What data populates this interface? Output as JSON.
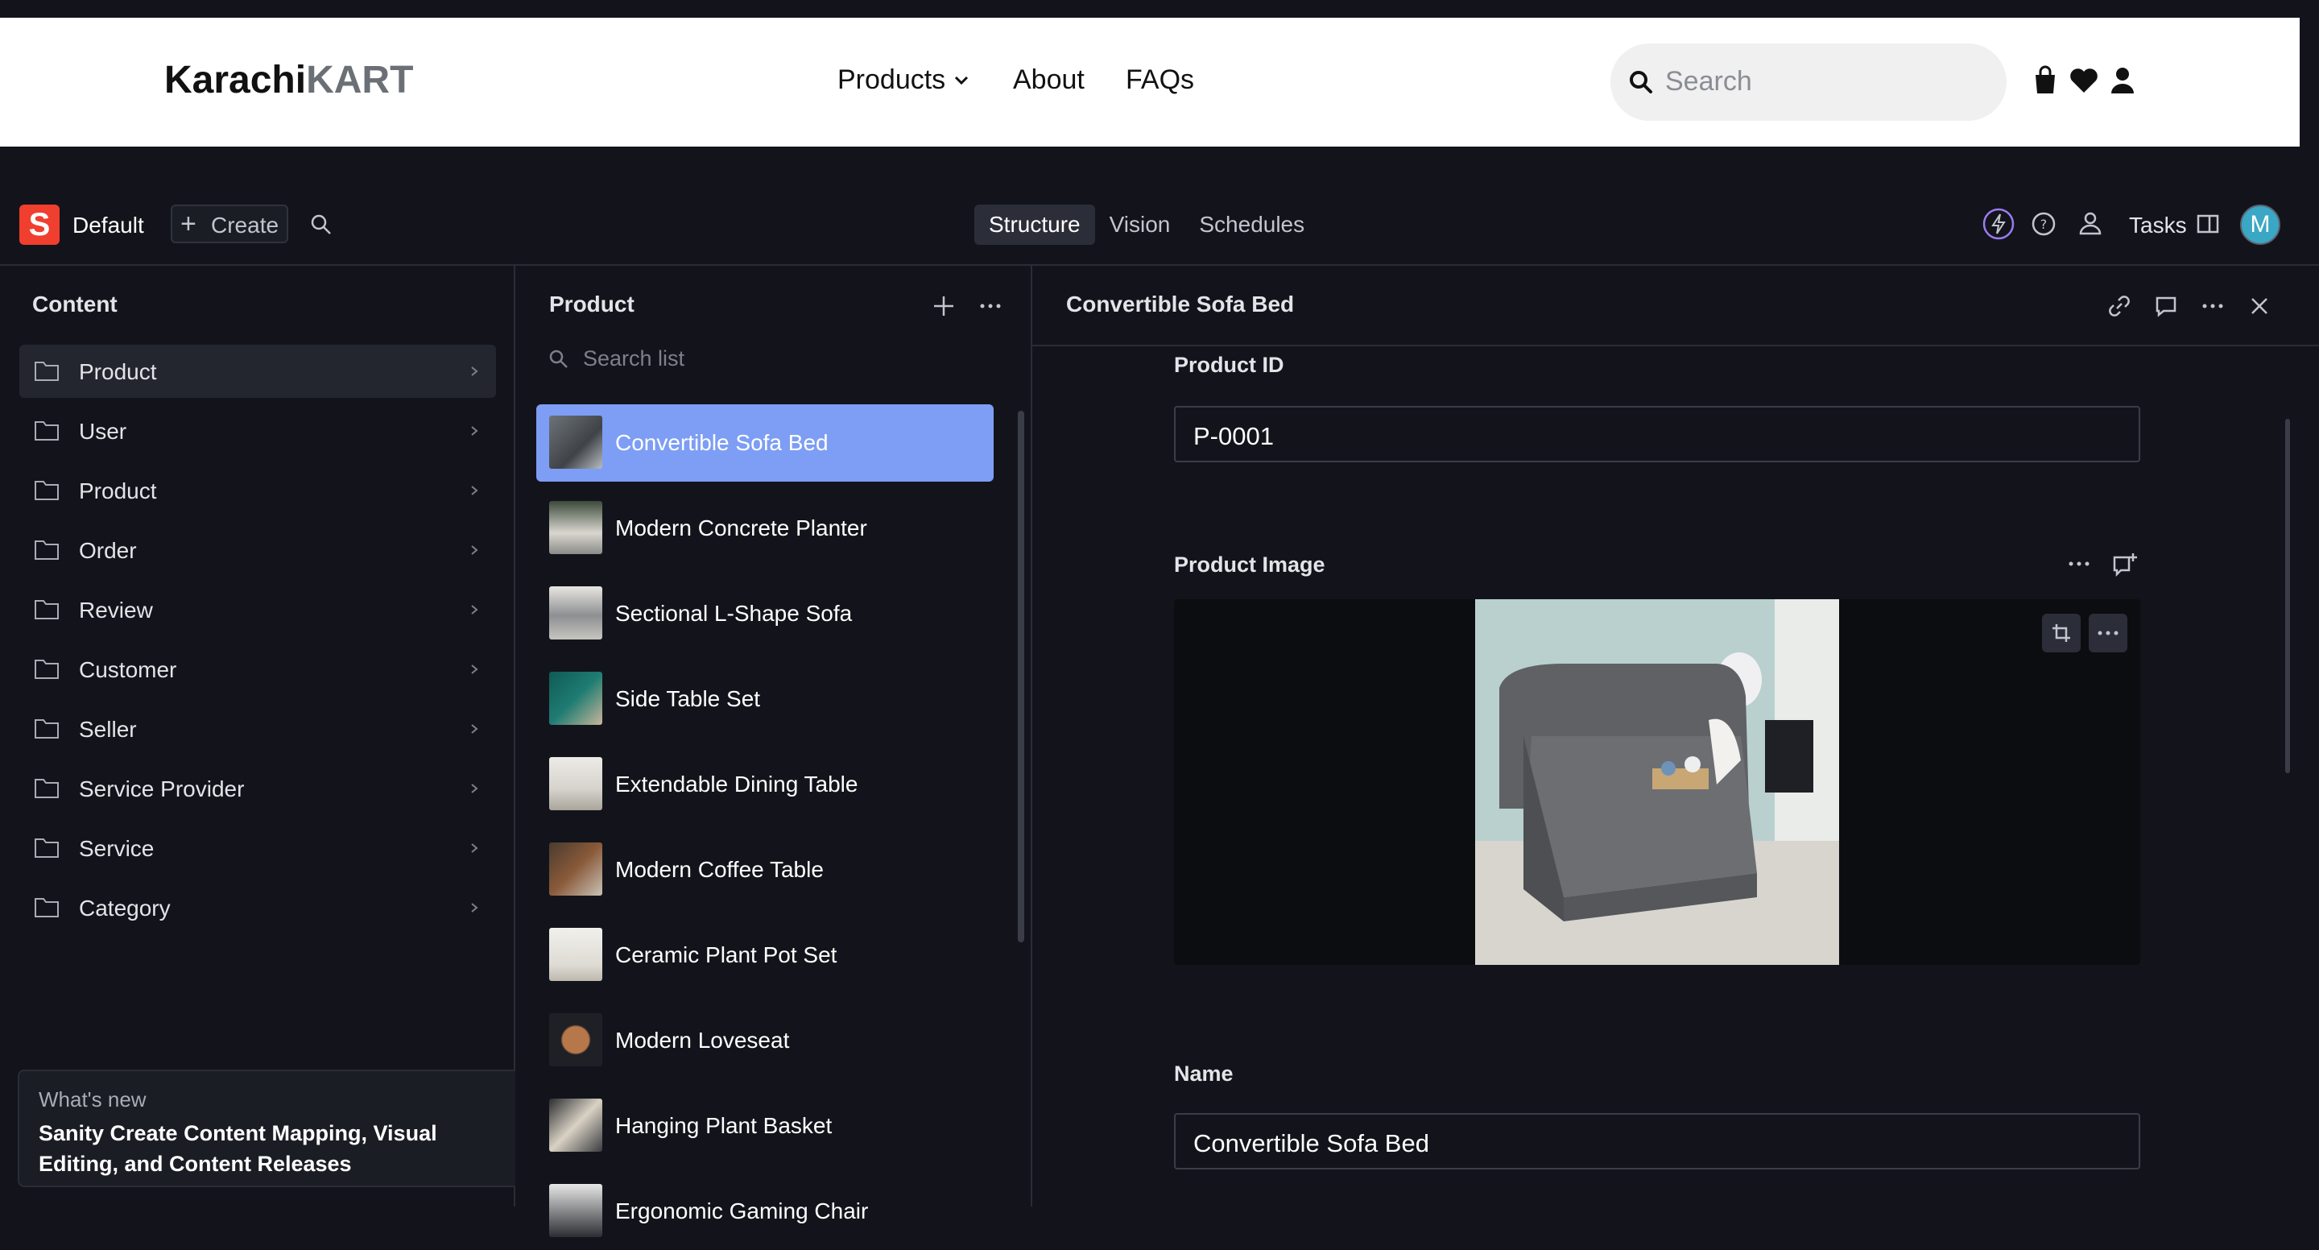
{
  "site": {
    "logo_part1": "Karachi",
    "logo_part2": "KART",
    "nav": [
      "Products",
      "About",
      "FAQs"
    ],
    "search_placeholder": "Search",
    "icons": [
      "shopping-bag-icon",
      "heart-icon",
      "user-icon"
    ]
  },
  "studio": {
    "workspace": "Default",
    "workspace_logo_letter": "S",
    "create_label": "Create",
    "tabs": [
      "Structure",
      "Vision",
      "Schedules"
    ],
    "active_tab": "Structure",
    "tasks_label": "Tasks",
    "avatar_letter": "M"
  },
  "content_pane": {
    "title": "Content",
    "items": [
      "Product",
      "User",
      "Product",
      "Order",
      "Review",
      "Customer",
      "Seller",
      "Service Provider",
      "Service",
      "Category"
    ],
    "selected_index": 0
  },
  "whats_new": {
    "heading": "What's new",
    "body": "Sanity Create Content Mapping, Visual Editing, and Content Releases"
  },
  "product_pane": {
    "title": "Product",
    "search_placeholder": "Search list",
    "items": [
      "Convertible Sofa Bed",
      "Modern Concrete Planter",
      "Sectional L-Shape Sofa",
      "Side Table Set",
      "Extendable Dining Table",
      "Modern Coffee Table",
      "Ceramic Plant Pot Set",
      "Modern Loveseat",
      "Hanging Plant Basket",
      "Ergonomic Gaming Chair"
    ],
    "selected_index": 0
  },
  "document": {
    "title": "Convertible Sofa Bed",
    "fields": {
      "product_id_label": "Product ID",
      "product_id_value": "P-0001",
      "product_image_label": "Product Image",
      "name_label": "Name",
      "name_value": "Convertible Sofa Bed"
    }
  },
  "colors": {
    "accent": "#7d9ef4",
    "brand": "#f03e2f",
    "background": "#13141b"
  }
}
